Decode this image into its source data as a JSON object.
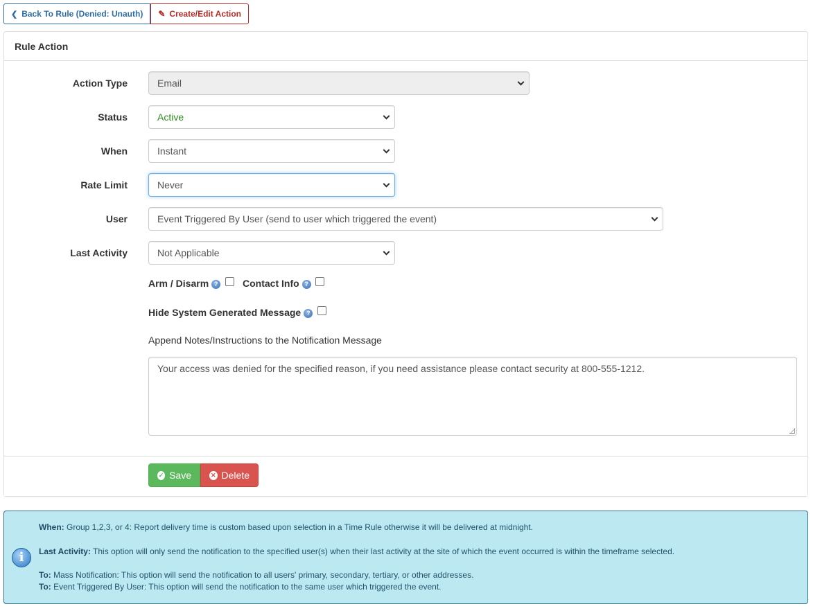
{
  "topbar": {
    "back_label": "Back To Rule (Denied: Unauth)",
    "edit_label": "Create/Edit Action"
  },
  "panel": {
    "title": "Rule Action"
  },
  "form": {
    "action_type": {
      "label": "Action Type",
      "value": "Email"
    },
    "status": {
      "label": "Status",
      "value": "Active"
    },
    "when": {
      "label": "When",
      "value": "Instant"
    },
    "rate_limit": {
      "label": "Rate Limit",
      "value": "Never"
    },
    "user": {
      "label": "User",
      "value": "Event Triggered By User (send to user which triggered the event)"
    },
    "last_activity": {
      "label": "Last Activity",
      "value": "Not Applicable"
    },
    "arm_disarm_label": "Arm / Disarm",
    "contact_info_label": "Contact Info",
    "hide_system_label": "Hide System Generated Message",
    "append_notes_label": "Append Notes/Instructions to the Notification Message",
    "notes_value": "Your access was denied for the specified reason, if you need assistance please contact security at 800-555-1212."
  },
  "footer": {
    "save_label": "Save",
    "delete_label": "Delete"
  },
  "info": {
    "when_key": "When:",
    "when_text": "Group 1,2,3, or 4: Report delivery time is custom based upon selection in a Time Rule otherwise it will be delivered at midnight.",
    "last_activity_key": "Last Activity:",
    "last_activity_text": "This option will only send the notification to the specified user(s) when their last activity at the site of which the event occurred is within the timeframe selected.",
    "to_key_1": "To:",
    "to_text_1": "Mass Notification: This option will send the notification to all users' primary, secondary, tertiary, or other addresses.",
    "to_key_2": "To:",
    "to_text_2": "Event Triggered By User: This option will send the notification to the same user which triggered the event."
  },
  "colors": {
    "primary": "#2e6da4",
    "danger": "#d9534f",
    "success": "#5cb85c",
    "info_bg": "#bce8f1"
  }
}
